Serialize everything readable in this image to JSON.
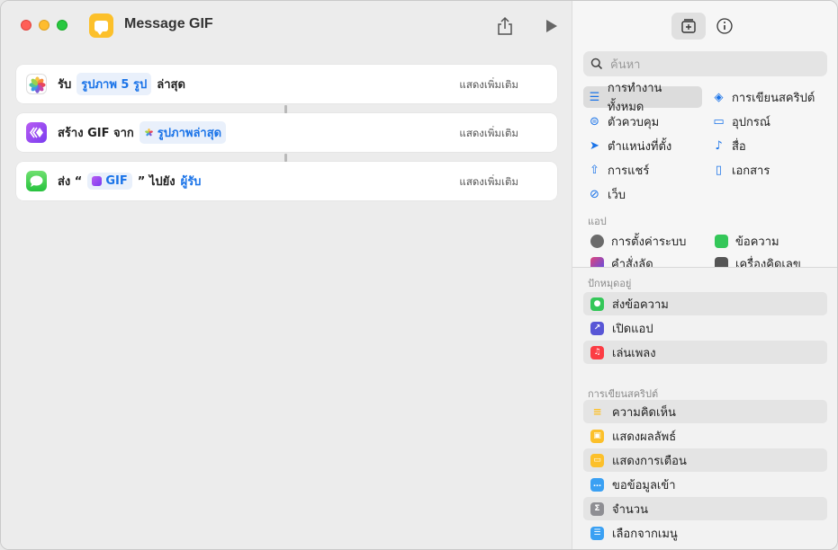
{
  "window": {
    "title": "Message GIF"
  },
  "editor": {
    "actions": [
      {
        "parts": [
          "รับ",
          "รูปภาพ 5 รูป",
          "ล่าสุด"
        ],
        "more": "แสดงเพิ่มเติม"
      },
      {
        "parts": [
          "สร้าง GIF จาก",
          "รูปภาพล่าสุด"
        ],
        "more": "แสดงเพิ่มเติม"
      },
      {
        "parts": [
          "ส่ง “",
          "GIF",
          "” ไปยัง",
          "ผู้รับ"
        ],
        "more": "แสดงเพิ่มเติม"
      }
    ]
  },
  "sidebar": {
    "search_placeholder": "ค้นหา",
    "categories": [
      {
        "label": "การทำงานทั้งหมด",
        "icon": "list-icon"
      },
      {
        "label": "การเขียนสคริปต์",
        "icon": "script-icon"
      },
      {
        "label": "ตัวควบคุม",
        "icon": "toggle-icon"
      },
      {
        "label": "อุปกรณ์",
        "icon": "display-icon"
      },
      {
        "label": "ตำแหน่งที่ตั้ง",
        "icon": "location-arrow-icon"
      },
      {
        "label": "สื่อ",
        "icon": "music-note-icon"
      },
      {
        "label": "การแชร์",
        "icon": "share-icon"
      },
      {
        "label": "เอกสาร",
        "icon": "document-icon"
      },
      {
        "label": "เว็บ",
        "icon": "compass-icon"
      }
    ],
    "apps_label": "แอป",
    "apps": [
      {
        "label": "การตั้งค่าระบบ",
        "icon": "settings-gear-icon"
      },
      {
        "label": "ข้อความ",
        "icon": "messages-icon"
      },
      {
        "label": "คำสั่งลัด",
        "icon": "shortcuts-icon"
      },
      {
        "label": "เครื่องคิดเลข",
        "icon": "calculator-icon"
      }
    ],
    "pinned_label": "ปักหมุดอยู่",
    "pinned": [
      {
        "label": "ส่งข้อความ",
        "icon": "messages-icon",
        "color": "#34c759"
      },
      {
        "label": "เปิดแอป",
        "icon": "open-app-icon",
        "color": "#5856d6"
      },
      {
        "label": "เล่นเพลง",
        "icon": "music-icon",
        "color": "#fc3c44"
      }
    ],
    "scripting_label": "การเขียนสคริปต์",
    "scripting": [
      {
        "label": "ความคิดเห็น",
        "icon": "comment-lines-icon",
        "color": "#fcc02a"
      },
      {
        "label": "แสดงผลลัพธ์",
        "icon": "show-result-icon",
        "color": "#fcc02a"
      },
      {
        "label": "แสดงการเตือน",
        "icon": "alert-icon",
        "color": "#fcc02a"
      },
      {
        "label": "ขอข้อมูลเข้า",
        "icon": "ask-input-icon",
        "color": "#3aa0f3"
      },
      {
        "label": "จำนวน",
        "icon": "sigma-icon",
        "color": "#8e8e93"
      },
      {
        "label": "เลือกจากเมนู",
        "icon": "menu-icon",
        "color": "#3aa0f3"
      }
    ]
  }
}
